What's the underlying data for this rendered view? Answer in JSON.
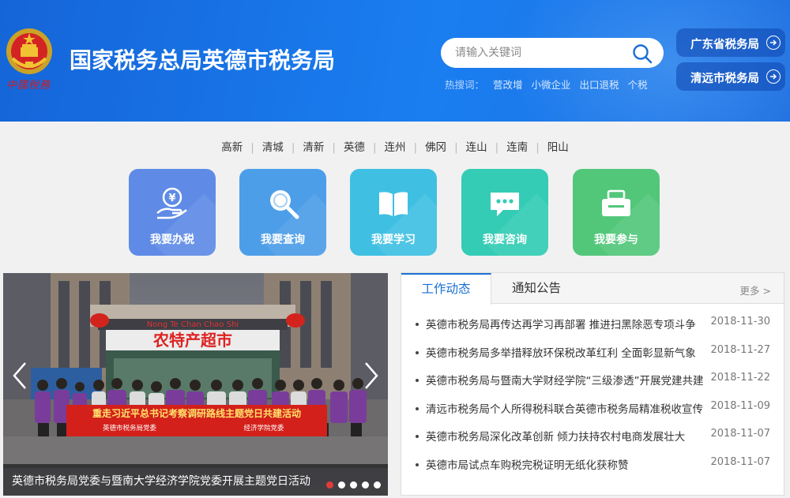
{
  "header": {
    "title": "国家税务总局英德市税务局",
    "emblem_script": "中國稅務",
    "search": {
      "placeholder": "请输入关键词"
    },
    "hot_label": "热搜词：",
    "hot_keywords": [
      "营改增",
      "小微企业",
      "出口退税",
      "个税"
    ],
    "region_links": [
      "广东省税务局",
      "清远市税务局"
    ]
  },
  "city_nav": [
    "高新",
    "清城",
    "清新",
    "英德",
    "连州",
    "佛冈",
    "连山",
    "连南",
    "阳山"
  ],
  "services": [
    {
      "label": "我要办税",
      "color": "#5f8be6",
      "icon": "tax-payment-icon"
    },
    {
      "label": "我要查询",
      "color": "#4c9ee8",
      "icon": "search-query-icon"
    },
    {
      "label": "我要学习",
      "color": "#3fc0e2",
      "icon": "book-icon"
    },
    {
      "label": "我要咨询",
      "color": "#34ccb5",
      "icon": "chat-icon"
    },
    {
      "label": "我要参与",
      "color": "#52c77a",
      "icon": "participate-icon"
    }
  ],
  "carousel": {
    "caption": "英德市税务局党委与暨南大学经济学院党委开展主题党日活动",
    "shop_sign": "农特产超市",
    "shop_sign_pinyin": "Nong Te Chan Chao Shi",
    "banner_text": "重走习近平总书记考察调研路线主题党日共建活动",
    "banner_left": "英德市税务局党委",
    "banner_right": "经济学院党委",
    "slide_count": 5,
    "active_index": 0
  },
  "news": {
    "tabs": [
      "工作动态",
      "通知公告"
    ],
    "active_tab": 0,
    "more_label": "更多 >",
    "items": [
      {
        "title": "英德市税务局再传达再学习再部署 推进扫黑除恶专项斗争",
        "date": "2018-11-30"
      },
      {
        "title": "英德市税务局多举措释放环保税改革红利 全面彰显新气象",
        "date": "2018-11-27"
      },
      {
        "title": "英德市税务局与暨南大学财经学院“三级渗透”开展党建共建",
        "date": "2018-11-22"
      },
      {
        "title": "清远市税务局个人所得税科联合英德市税务局精准税收宣传",
        "date": "2018-11-09"
      },
      {
        "title": "英德市税务局深化改革创新 倾力扶持农村电商发展壮大",
        "date": "2018-11-07"
      },
      {
        "title": "英德市局试点车购税完税证明无纸化获称赞",
        "date": "2018-11-07"
      }
    ]
  }
}
